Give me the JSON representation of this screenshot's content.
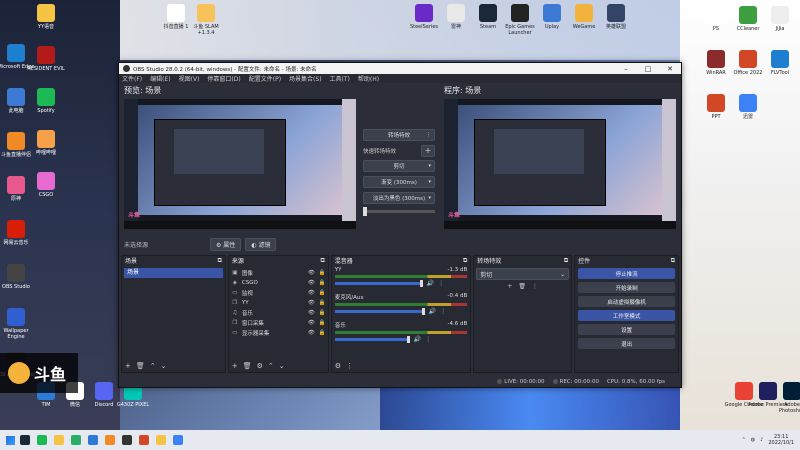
{
  "desktop": {
    "icons_left": [
      {
        "label": "Microsoft Edge",
        "color": "#1e7fd0"
      },
      {
        "label": "此电脑",
        "color": "#3d7ad6"
      },
      {
        "label": "斗鱼直播伴侣",
        "color": "#f08a24"
      },
      {
        "label": "原神",
        "color": "#e7588c"
      },
      {
        "label": "网易云音乐",
        "color": "#d81e06"
      },
      {
        "label": "OBS Studio",
        "color": "#444444"
      },
      {
        "label": "Wallpaper Engine",
        "color": "#2f5fd0"
      },
      {
        "label": "MSI Afterburner",
        "color": "#333333"
      }
    ],
    "icons_left2": [
      {
        "label": "YY语音",
        "color": "#f6c445"
      },
      {
        "label": "RESIDENT EVIL",
        "color": "#b31b1b"
      },
      {
        "label": "Spotify",
        "color": "#1db954"
      },
      {
        "label": "哔哩哔哩",
        "color": "#f7a04a"
      },
      {
        "label": "CSGO",
        "color": "#e56bd0"
      }
    ],
    "icons_bottom": [
      {
        "label": "TIM",
        "color": "#2d7bd6"
      },
      {
        "label": "微信",
        "color": "#ffffff"
      },
      {
        "label": "Discord",
        "color": "#5865f2"
      },
      {
        "label": "G430Z PIXEL",
        "color": "#00c8b4"
      }
    ],
    "icons_top": [
      {
        "label": "抖音直播 1",
        "color": "#ffffff"
      },
      {
        "label": "斗鱼 SLAM +1.3.4",
        "color": "#f7c25a"
      },
      {
        "label": "SteelSeries",
        "color": "#6a2ac8"
      },
      {
        "label": "雷神",
        "color": "#e8e8e8"
      },
      {
        "label": "Steam",
        "color": "#1b2838"
      },
      {
        "label": "Epic Games Launcher",
        "color": "#222222"
      },
      {
        "label": "Uplay",
        "color": "#3d7ad6"
      },
      {
        "label": "WeGame",
        "color": "#f2b33d"
      },
      {
        "label": "英雄联盟",
        "color": "#334466"
      }
    ],
    "icons_right": [
      {
        "label": "PS",
        "color": "#ffffff"
      },
      {
        "label": "CCleaner",
        "color": "#3d9f40"
      },
      {
        "label": "JiJia",
        "color": "#eeeeee"
      },
      {
        "label": "WinRAR",
        "color": "#8b2c2c"
      },
      {
        "label": "Office 2022",
        "color": "#d24726"
      },
      {
        "label": "FLVTool",
        "color": "#1e7fd0"
      },
      {
        "label": "PPT",
        "color": "#d24726"
      },
      {
        "label": "迅雷",
        "color": "#3b82f6"
      },
      {
        "label": "Google Chrome",
        "color": "#e94235"
      },
      {
        "label": "Adobe Premiere",
        "color": "#1f1f5f"
      },
      {
        "label": "Adobe Photoshop",
        "color": "#001e36"
      }
    ],
    "watermark": {
      "text": "斗鱼"
    }
  },
  "obs": {
    "title": "OBS Studio 28.0.2 (64-bit, windows) - 配置文件: 未命名 - 场景: 未命名",
    "menu": [
      "文件(F)",
      "编辑(E)",
      "视图(V)",
      "停靠窗口(D)",
      "配置文件(P)",
      "场景集合(S)",
      "工具(T)",
      "帮助(H)"
    ],
    "preview_label": "预览: 场景",
    "program_label": "程序: 场景",
    "transition": {
      "transition_button": "转场特效",
      "quick_label": "快速转场特效",
      "cut": "剪切",
      "fade": "渐变 (300ms)",
      "stinger": "淡出为黑色 (300ms)"
    },
    "source_toolbar": {
      "no_selection": "未选择源",
      "properties": "属性",
      "filters": "滤镜"
    },
    "docks": {
      "scenes_title": "场景",
      "scenes": [
        "场景"
      ],
      "sources_title": "来源",
      "sources": [
        {
          "name": "图像",
          "icon": "image-icon"
        },
        {
          "name": "CSGO",
          "icon": "game-capture-icon"
        },
        {
          "name": "监视",
          "icon": "display-capture-icon"
        },
        {
          "name": "YY",
          "icon": "window-capture-icon"
        },
        {
          "name": "音乐",
          "icon": "audio-icon"
        },
        {
          "name": "窗口采集",
          "icon": "window-capture-icon"
        },
        {
          "name": "显示器采集",
          "icon": "display-capture-icon"
        }
      ],
      "mixer_title": "混音器",
      "mixer": [
        {
          "name": "YY",
          "db": "-1.3 dB",
          "level": 0.88
        },
        {
          "name": "麦克风/Aux",
          "db": "-0.4 dB",
          "level": 0.9
        },
        {
          "name": "音乐",
          "db": "-4.6 dB",
          "level": 0.75
        }
      ],
      "transitions_title": "转场特效",
      "transition_selected": "剪切",
      "controls_title": "控件",
      "controls": [
        {
          "label": "停止推流",
          "style": "blue"
        },
        {
          "label": "开始录制",
          "style": "gray"
        },
        {
          "label": "启动虚拟摄像机",
          "style": "gray"
        },
        {
          "label": "工作室模式",
          "style": "blue"
        },
        {
          "label": "设置",
          "style": "gray"
        },
        {
          "label": "退出",
          "style": "gray"
        }
      ]
    },
    "status": {
      "live": "LIVE: 00:00:00",
      "rec": "REC: 00:00:00",
      "cpu": "CPU: 0.8%, 60.00 fps"
    }
  },
  "taskbar": {
    "apps": [
      {
        "name": "steam-taskbar",
        "color": "#1b2838"
      },
      {
        "name": "spotify-taskbar",
        "color": "#1db954"
      },
      {
        "name": "folder-taskbar",
        "color": "#f6c445"
      },
      {
        "name": "wechat-taskbar",
        "color": "#2aae67"
      },
      {
        "name": "tim-taskbar",
        "color": "#2d7bd6"
      },
      {
        "name": "douyu-taskbar",
        "color": "#f08a24"
      },
      {
        "name": "obs-taskbar",
        "color": "#333333"
      },
      {
        "name": "app-taskbar",
        "color": "#d24726"
      },
      {
        "name": "notes-taskbar",
        "color": "#f6c445"
      },
      {
        "name": "media-taskbar",
        "color": "#3b82f6"
      }
    ],
    "time": "23:11",
    "date": "2022/10/1"
  }
}
